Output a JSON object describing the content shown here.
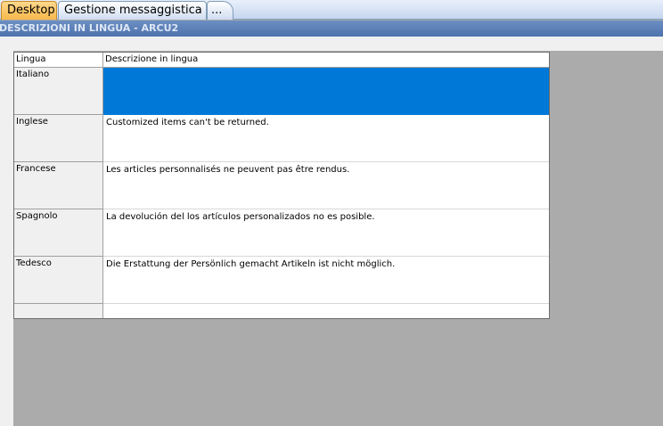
{
  "tabs": [
    {
      "label": "Desktop"
    },
    {
      "label": "Gestione messaggistica"
    },
    {
      "label": "..."
    }
  ],
  "title": "DESCRIZIONI IN LINGUA - ARCU2",
  "grid": {
    "headers": {
      "language": "Lingua",
      "description": "Descrizione in lingua"
    },
    "rows": [
      {
        "language": "Italiano",
        "description": ""
      },
      {
        "language": "Inglese",
        "description": "Customized items can't be returned."
      },
      {
        "language": "Francese",
        "description": "Les articles personnalisés ne peuvent pas être rendus."
      },
      {
        "language": "Spagnolo",
        "description": "La devolución del los artículos personalizados no es posible."
      },
      {
        "language": "Tedesco",
        "description": "Die Erstattung der Persönlich gemacht Artikeln ist nicht möglich."
      }
    ]
  },
  "colors": {
    "selection": "#0078d7",
    "active_tab": "#f7b84b",
    "title_band": "#4d72ad",
    "workspace": "#ababab"
  }
}
